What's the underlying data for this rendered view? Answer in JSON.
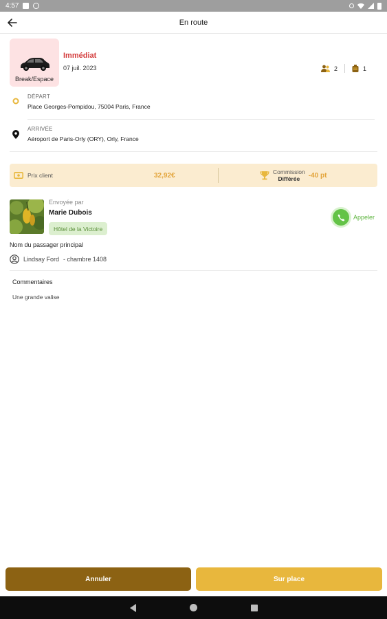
{
  "status_bar": {
    "time": "4:57"
  },
  "header": {
    "title": "En route",
    "back_icon": "arrow-left-icon"
  },
  "ride": {
    "vehicle_type": "Break/Espace",
    "timing": "Immédiat",
    "date": "07 juil. 2023",
    "passengers": "2",
    "luggage": "1"
  },
  "departure": {
    "label": "DÉPART",
    "address": "Place Georges-Pompidou, 75004 Paris, France"
  },
  "arrival": {
    "label": "ARRIVÉE",
    "address": "Aéroport de Paris-Orly (ORY), Orly, France"
  },
  "pricing": {
    "price_label": "Prix client",
    "price_value": "32,92€",
    "commission_label_1": "Commission",
    "commission_label_2": "Différée",
    "commission_value": "-40 pt"
  },
  "sender": {
    "sent_by_label": "Envoyée par",
    "name": "Marie Dubois",
    "hotel": "Hôtel de la Victoire",
    "call_label": "Appeler"
  },
  "passenger": {
    "title": "Nom du passager principal",
    "name": "Lindsay Ford",
    "room": "- chambre 1408"
  },
  "comments": {
    "title": "Commentaires",
    "text": "Une grande valise"
  },
  "actions": {
    "cancel": "Annuler",
    "on_site": "Sur place"
  },
  "colors": {
    "accent": "#e8b73d",
    "accent_dark": "#8c6213",
    "danger": "#d33a3a",
    "success": "#63c347",
    "price_bg": "#fbecd0",
    "vehicle_bg": "#fde2e3"
  }
}
